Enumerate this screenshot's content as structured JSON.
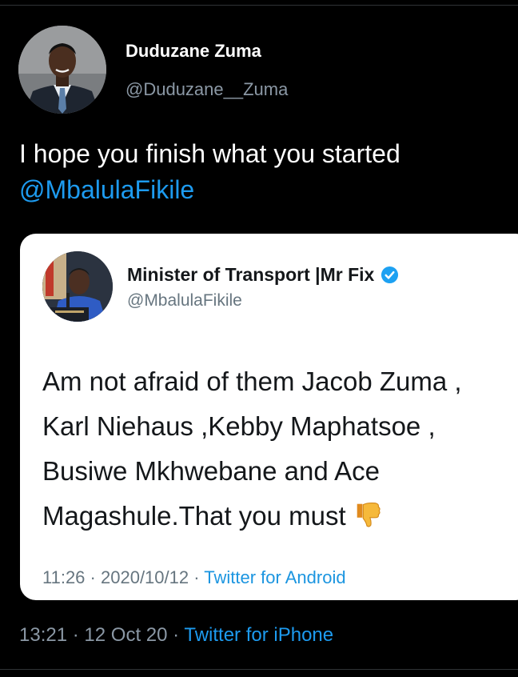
{
  "tweet": {
    "author_name": "Duduzane Zuma",
    "author_handle": "@Duduzane__Zuma",
    "text": "I hope you finish what you started",
    "mention": "@MbalulaFikile",
    "time": "13:21",
    "date": "12 Oct 20",
    "separator": "·",
    "source": "Twitter for iPhone"
  },
  "quoted": {
    "author_name": "Minister of Transport |Mr Fix",
    "author_handle": "@MbalulaFikile",
    "verified_icon": "verified-badge-icon",
    "lines": [
      "Am not afraid of them Jacob Zuma ,",
      "Karl Niehaus ,Kebby Maphatsoe ,",
      "Busiwe Mkhwebane and  Ace",
      "Magashule.That you must"
    ],
    "emoji_icon": "thumbs-down-icon",
    "time": "11:26",
    "date": "2020/10/12",
    "separator": "·",
    "source": "Twitter for Android"
  },
  "colors": {
    "background": "#000000",
    "link": "#1d9bf0",
    "muted": "#8b98a5",
    "card": "#ffffff"
  }
}
